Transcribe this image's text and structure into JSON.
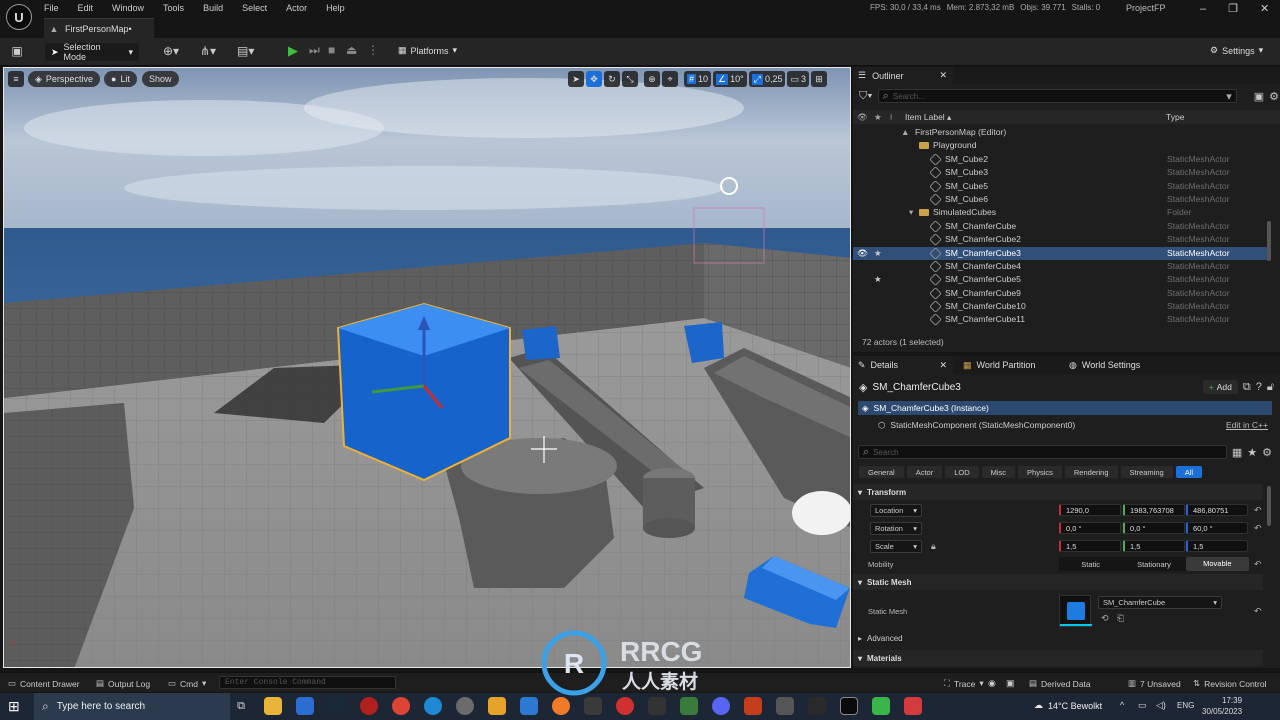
{
  "menubar": {
    "logo": "U",
    "menus": [
      "File",
      "Edit",
      "Window",
      "Tools",
      "Build",
      "Select",
      "Actor",
      "Help"
    ],
    "stats": {
      "fps": "FPS: 30,0 / 33,4 ms",
      "mem": "Mem: 2.873,32 mB",
      "objs": "Objs: 39.771",
      "stalls": "Stalls: 0"
    },
    "project": "ProjectFP"
  },
  "tab": {
    "title": "FirstPersonMap•"
  },
  "toolbar": {
    "selection_mode": "Selection Mode",
    "platforms": "Platforms",
    "settings": "Settings"
  },
  "viewport": {
    "perspective": "Perspective",
    "lit": "Lit",
    "show": "Show",
    "grid_snap": "10",
    "rot_snap": "10°",
    "scale_snap": "0,25",
    "camera_speed": "3"
  },
  "outliner": {
    "tab": "Outliner",
    "search_placeholder": "Search...",
    "col_label": "Item Label ▴",
    "col_type": "Type",
    "items": [
      {
        "label": "FirstPersonMap (Editor)",
        "type": "",
        "indent": 0
      },
      {
        "label": "Playground",
        "type": "",
        "indent": 1,
        "folder": true
      },
      {
        "label": "SM_Cube2",
        "type": "StaticMeshActor",
        "indent": 2
      },
      {
        "label": "SM_Cube3",
        "type": "StaticMeshActor",
        "indent": 2
      },
      {
        "label": "SM_Cube5",
        "type": "StaticMeshActor",
        "indent": 2
      },
      {
        "label": "SM_Cube6",
        "type": "StaticMeshActor",
        "indent": 2
      },
      {
        "label": "SimulatedCubes",
        "type": "Folder",
        "indent": 1,
        "folder": true
      },
      {
        "label": "SM_ChamferCube",
        "type": "StaticMeshActor",
        "indent": 2
      },
      {
        "label": "SM_ChamferCube2",
        "type": "StaticMeshActor",
        "indent": 2
      },
      {
        "label": "SM_ChamferCube3",
        "type": "StaticMeshActor",
        "indent": 2,
        "selected": true
      },
      {
        "label": "SM_ChamferCube4",
        "type": "StaticMeshActor",
        "indent": 2
      },
      {
        "label": "SM_ChamferCube5",
        "type": "StaticMeshActor",
        "indent": 2
      },
      {
        "label": "SM_ChamferCube9",
        "type": "StaticMeshActor",
        "indent": 2
      },
      {
        "label": "SM_ChamferCube10",
        "type": "StaticMeshActor",
        "indent": 2
      },
      {
        "label": "SM_ChamferCube11",
        "type": "StaticMeshActor",
        "indent": 2
      }
    ],
    "footer": "72 actors (1 selected)"
  },
  "details": {
    "tabs": [
      "Details",
      "World Partition",
      "World Settings"
    ],
    "actor_name": "SM_ChamferCube3",
    "add_label": "Add",
    "instance": "SM_ChamferCube3 (Instance)",
    "component": "StaticMeshComponent (StaticMeshComponent0)",
    "edit_cpp": "Edit in C++",
    "search_placeholder": "Search",
    "filters": [
      "General",
      "Actor",
      "LOD",
      "Misc",
      "Physics",
      "Rendering",
      "Streaming",
      "All"
    ],
    "transform": {
      "title": "Transform",
      "location_label": "Location",
      "location": [
        "1290,0",
        "1983,763708",
        "486,80751"
      ],
      "rotation_label": "Rotation",
      "rotation": [
        "0,0 °",
        "0,0 °",
        "60,0 °"
      ],
      "scale_label": "Scale",
      "scale": [
        "1,5",
        "1,5",
        "1,5"
      ],
      "mobility_label": "Mobility",
      "mobility": [
        "Static",
        "Stationary",
        "Movable"
      ]
    },
    "static_mesh": {
      "title": "Static Mesh",
      "prop": "Static Mesh",
      "value": "SM_ChamferCube"
    },
    "advanced": "Advanced",
    "materials": "Materials"
  },
  "statusbar": {
    "content_drawer": "Content Drawer",
    "output_log": "Output Log",
    "cmd": "Cmd",
    "console_placeholder": "Enter Console Command",
    "trace": "Trace",
    "derived": "Derived Data",
    "unsaved": "7 Unsaved",
    "revision": "Revision Control"
  },
  "taskbar": {
    "search_placeholder": "Type here to search",
    "weather": "14°C  Bewolkt",
    "lang": "ENG",
    "time": "17:39",
    "date": "30/05/2023"
  },
  "watermark": {
    "brand": "RRCG",
    "sub": "人人素材"
  }
}
